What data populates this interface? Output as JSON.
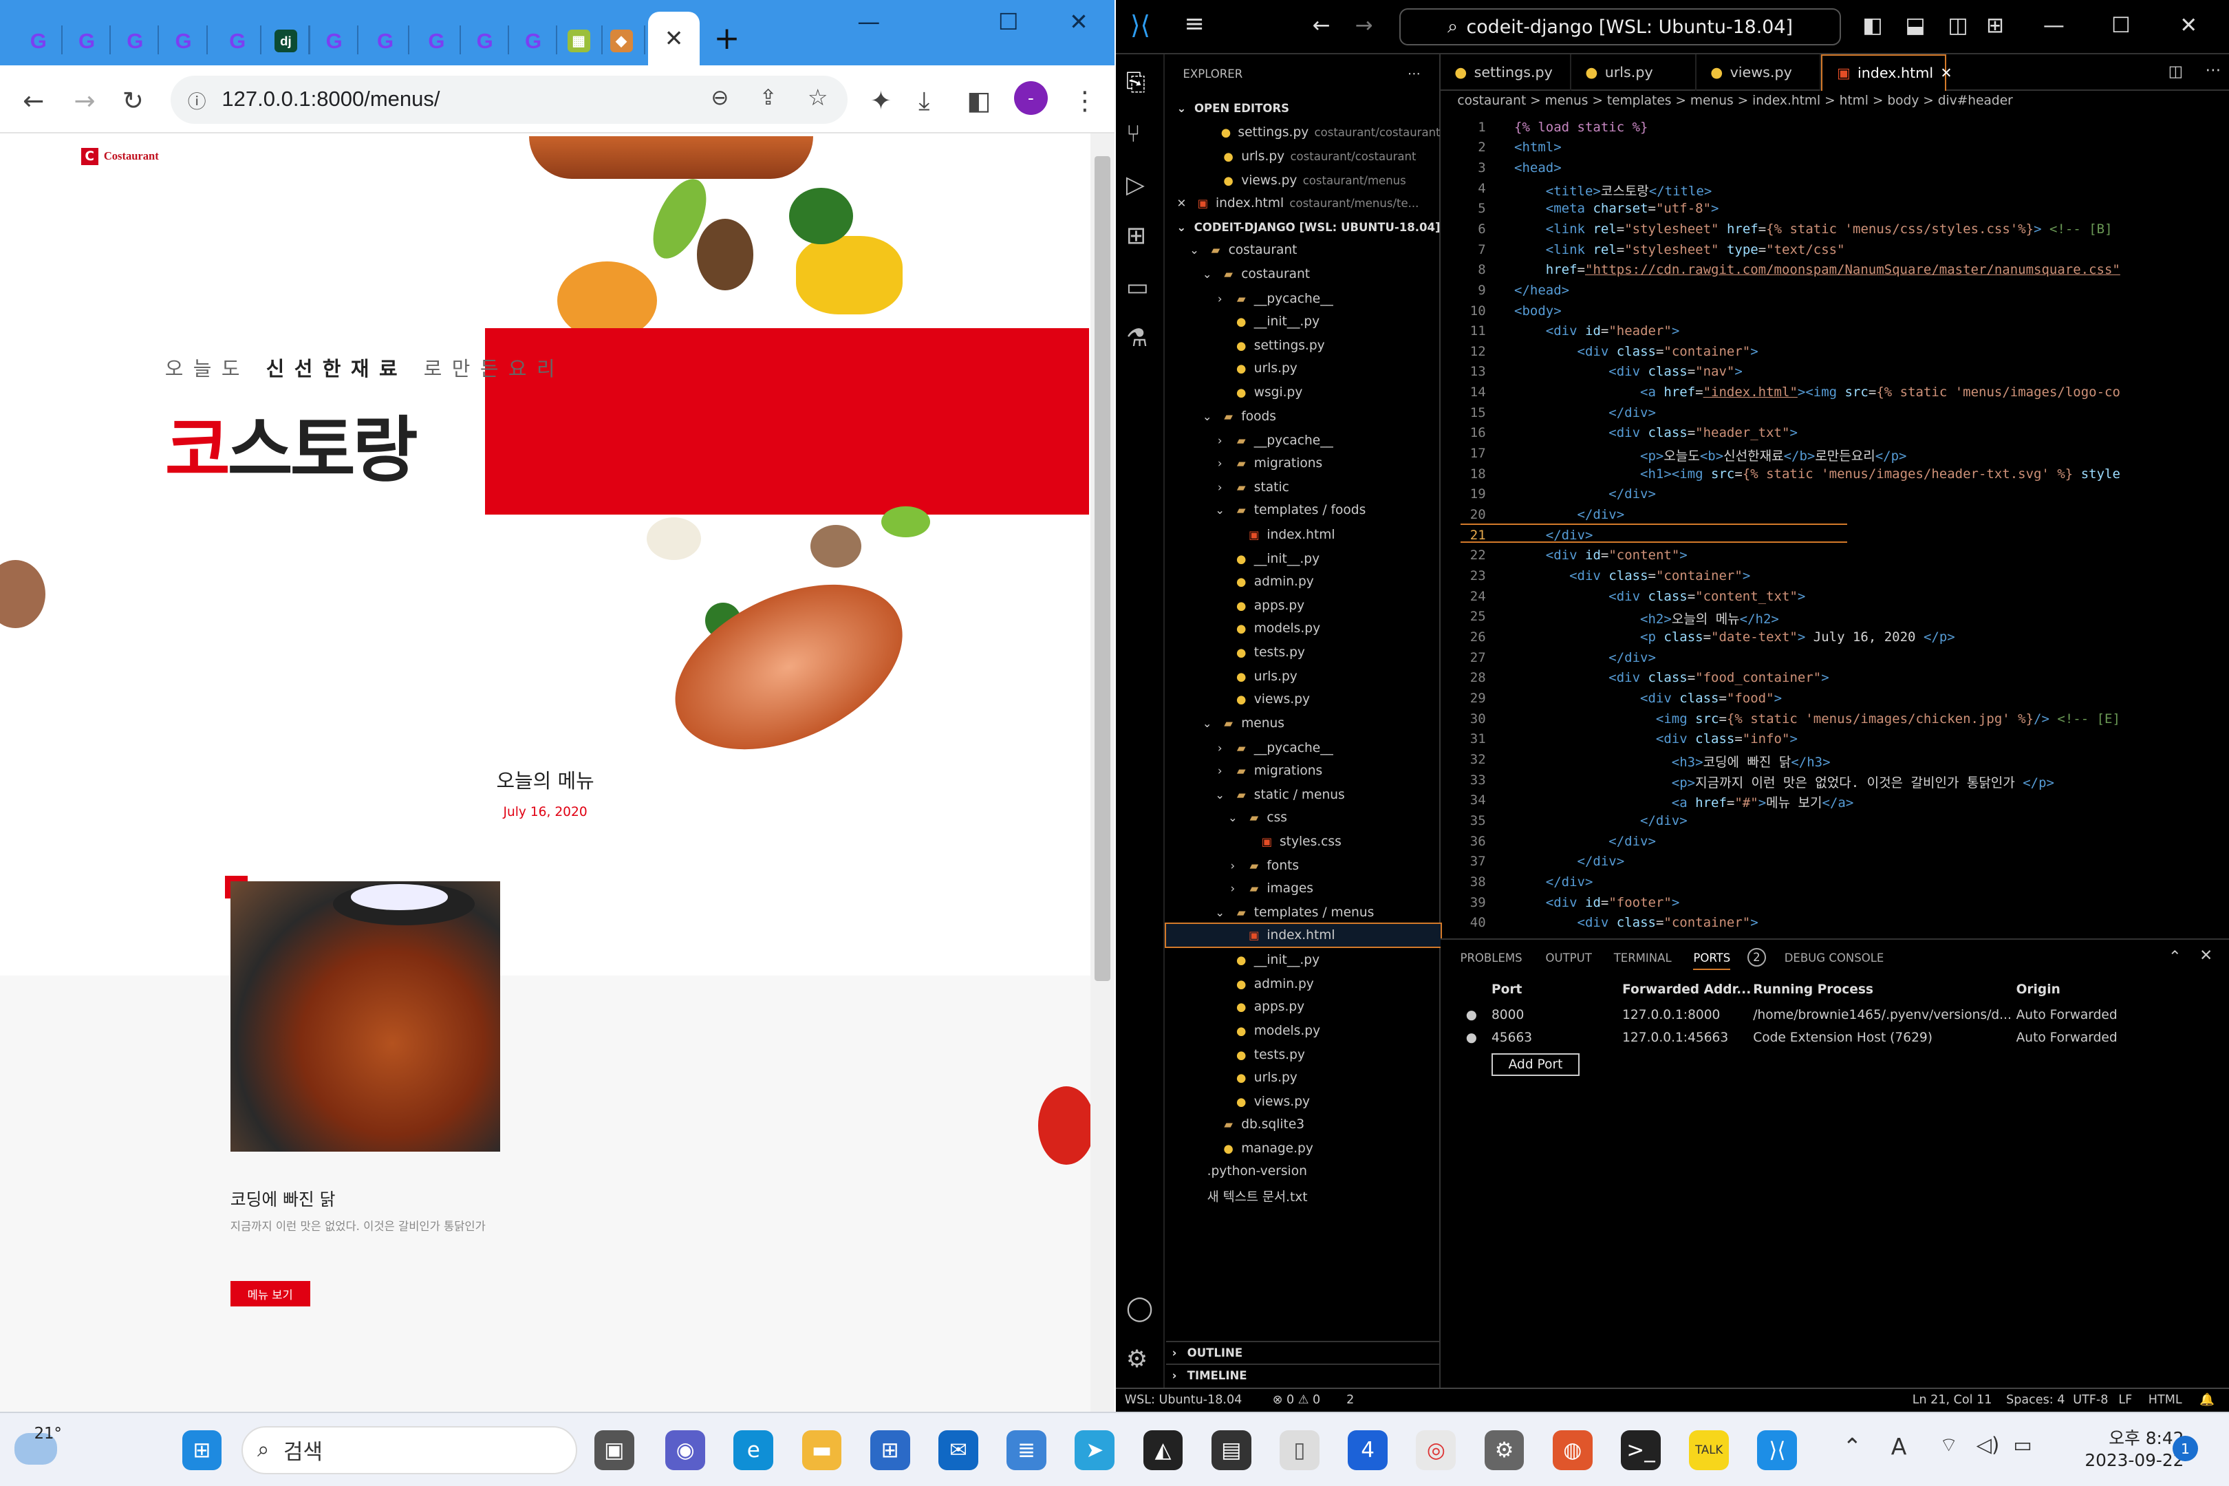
{
  "browser": {
    "tab_count_favicons": [
      "c",
      "c",
      "c",
      "c",
      "c",
      "dj",
      "c",
      "c",
      "c",
      "c",
      "c",
      "gr",
      "or"
    ],
    "active_tab_close": "✕",
    "new_tab": "+",
    "url": "127.0.0.1:8000/menus/",
    "profile_initial": "-"
  },
  "site": {
    "logo_text": "Costaurant",
    "logo_letter": "C",
    "subtitle_pre": "오늘도",
    "subtitle_bold": "신선한재료",
    "subtitle_post": "로만든요리",
    "title_first": "코",
    "title_rest": "스토랑",
    "menu_heading": "오늘의 메뉴",
    "date": "July 16, 2020",
    "food_name": "코딩에 빠진 닭",
    "food_desc": "지금까지 이런 맛은 없었다. 이것은 갈비인가 통닭인가",
    "food_button": "메뉴 보기"
  },
  "vscode": {
    "search": "codeit-django [WSL: Ubuntu-18.04]",
    "explorer_title": "EXPLORER",
    "open_editors": "OPEN EDITORS",
    "workspace": "CODEIT-DJANGO [WSL: UBUNTU-18.04]",
    "tabs": [
      "settings.py",
      "urls.py",
      "views.py",
      "index.html"
    ],
    "breadcrumbs": "costaurant > menus > templates > menus > index.html > html > body > div#header",
    "outline": "OUTLINE",
    "timeline": "TIMELINE",
    "panel_tabs": [
      "PROBLEMS",
      "OUTPUT",
      "TERMINAL",
      "PORTS",
      "DEBUG CONSOLE"
    ],
    "ports_badge": "2",
    "ports_headers": [
      "Port",
      "Forwarded Addr...",
      "Running Process",
      "Origin"
    ],
    "ports": [
      {
        "port": "8000",
        "addr": "127.0.0.1:8000",
        "proc": "/home/brownie1465/.pyenv/versions/d...",
        "origin": "Auto Forwarded"
      },
      {
        "port": "45663",
        "addr": "127.0.0.1:45663",
        "proc": "Code Extension Host (7629)",
        "origin": "Auto Forwarded"
      }
    ],
    "add_port": "Add Port",
    "status": {
      "remote": "WSL: Ubuntu-18.04",
      "problems": "⊗ 0 ⚠ 0",
      "ports": "2",
      "cursor": "Ln 21, Col 11",
      "spaces": "Spaces: 4",
      "encoding": "UTF-8",
      "eol": "LF",
      "lang": "HTML"
    }
  },
  "taskbar": {
    "weather": "21°",
    "search": "검색",
    "time": "오후 8:42",
    "date": "2023-09-22",
    "notif": "1"
  }
}
